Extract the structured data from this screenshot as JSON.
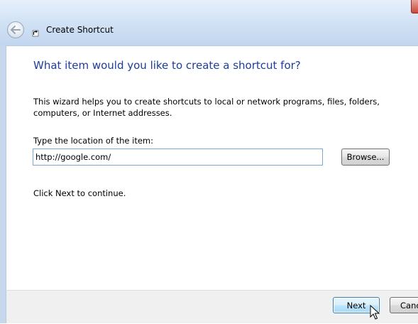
{
  "window": {
    "title": "Create Shortcut"
  },
  "page": {
    "heading": "What item would you like to create a shortcut for?",
    "description": "This wizard helps you to create shortcuts to local or network programs, files, folders, computers, or Internet addresses.",
    "location_label": "Type the location of the item:",
    "location_value": "http://google.com/",
    "browse_label": "Browse...",
    "continue_text": "Click Next to continue."
  },
  "footer": {
    "next_label": "Next",
    "cancel_label": "Cancel"
  },
  "colors": {
    "heading": "#1e3d9a",
    "frame": "#c6d8ee",
    "close": "#c9473a"
  },
  "icons": [
    "back-arrow-icon",
    "shortcut-arrow-icon",
    "mouse-cursor-icon"
  ]
}
